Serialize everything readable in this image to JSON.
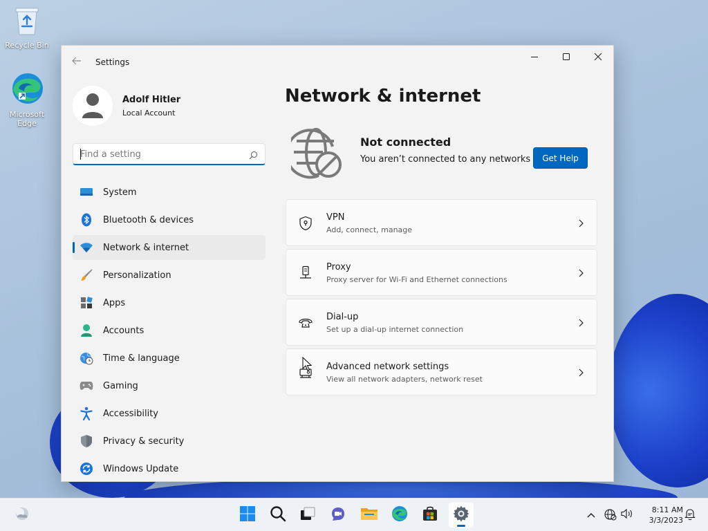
{
  "desktop": {
    "icons": [
      {
        "label": "Recycle Bin"
      },
      {
        "label": "Microsoft Edge"
      }
    ]
  },
  "window": {
    "title": "Settings",
    "controls": {
      "minimize": "minimize-icon",
      "maximize": "maximize-icon",
      "close": "close-icon"
    }
  },
  "user": {
    "name": "Adolf Hitler",
    "account_type": "Local Account"
  },
  "search": {
    "placeholder": "Find a setting",
    "value": ""
  },
  "sidebar": {
    "items": [
      {
        "label": "System",
        "icon": "system-icon",
        "active": false
      },
      {
        "label": "Bluetooth & devices",
        "icon": "bluetooth-icon",
        "active": false
      },
      {
        "label": "Network & internet",
        "icon": "wifi-icon",
        "active": true
      },
      {
        "label": "Personalization",
        "icon": "brush-icon",
        "active": false
      },
      {
        "label": "Apps",
        "icon": "apps-icon",
        "active": false
      },
      {
        "label": "Accounts",
        "icon": "accounts-icon",
        "active": false
      },
      {
        "label": "Time & language",
        "icon": "clock-globe-icon",
        "active": false
      },
      {
        "label": "Gaming",
        "icon": "gamepad-icon",
        "active": false
      },
      {
        "label": "Accessibility",
        "icon": "accessibility-icon",
        "active": false
      },
      {
        "label": "Privacy & security",
        "icon": "shield-icon",
        "active": false
      },
      {
        "label": "Windows Update",
        "icon": "update-icon",
        "active": false
      }
    ]
  },
  "main": {
    "title": "Network & internet",
    "status": {
      "title": "Not connected",
      "subtitle": "You aren’t connected to any networks",
      "help_button": "Get Help"
    },
    "cards": [
      {
        "title": "VPN",
        "subtitle": "Add, connect, manage",
        "icon": "vpn-shield-icon"
      },
      {
        "title": "Proxy",
        "subtitle": "Proxy server for Wi-Fi and Ethernet connections",
        "icon": "proxy-icon"
      },
      {
        "title": "Dial-up",
        "subtitle": "Set up a dial-up internet connection",
        "icon": "dialup-phone-icon"
      },
      {
        "title": "Advanced network settings",
        "subtitle": "View all network adapters, network reset",
        "icon": "network-adapter-icon"
      }
    ]
  },
  "taskbar": {
    "time": "8:11 AM",
    "date": "3/3/2023"
  },
  "colors": {
    "accent": "#0067c0",
    "window_bg": "#f3f3f3",
    "card_bg": "#fbfbfb"
  }
}
